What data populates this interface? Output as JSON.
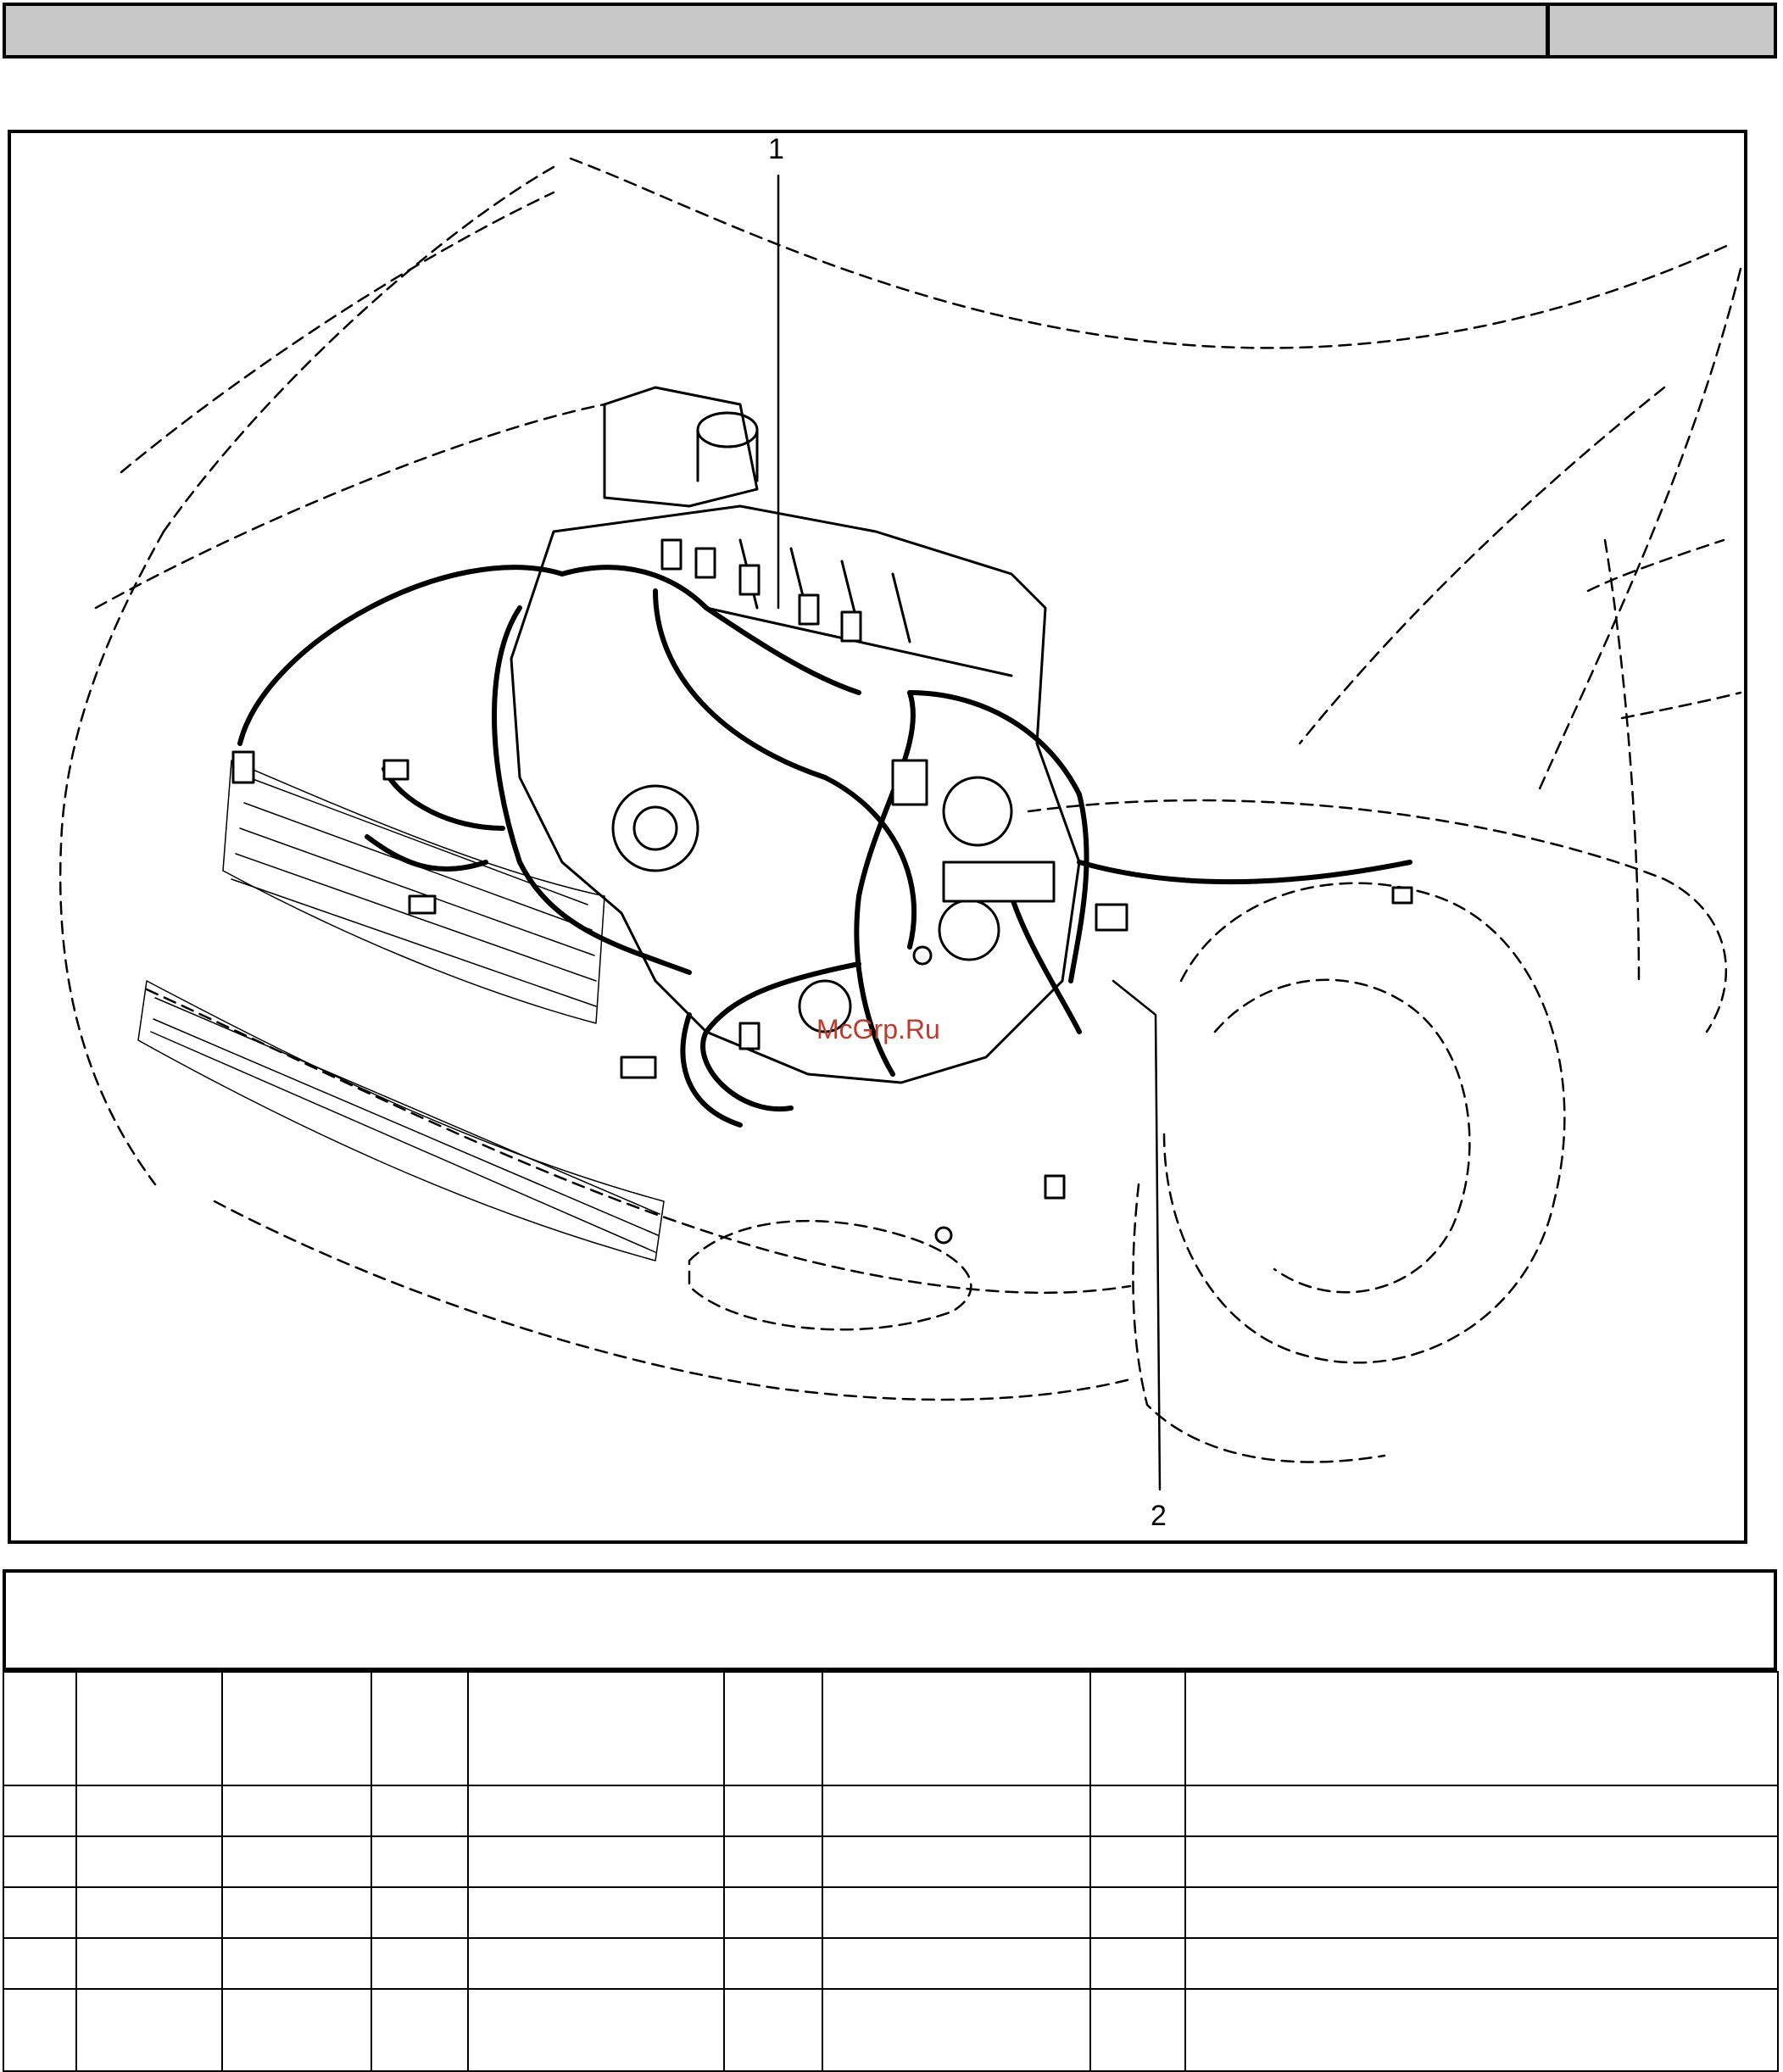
{
  "header": {
    "title": "",
    "code": ""
  },
  "figure": {
    "callouts": [
      {
        "id": "callout-1",
        "label": "1"
      },
      {
        "id": "callout-2",
        "label": "2"
      }
    ],
    "watermark": "McGrp.Ru"
  },
  "caption": {
    "text": ""
  },
  "parts_table": {
    "columns": 9,
    "rows": [
      [
        "",
        "",
        "",
        "",
        "",
        "",
        "",
        "",
        ""
      ],
      [
        "",
        "",
        "",
        "",
        "",
        "",
        "",
        "",
        ""
      ],
      [
        "",
        "",
        "",
        "",
        "",
        "",
        "",
        "",
        ""
      ],
      [
        "",
        "",
        "",
        "",
        "",
        "",
        "",
        "",
        ""
      ],
      [
        "",
        "",
        "",
        "",
        "",
        "",
        "",
        "",
        ""
      ],
      [
        "",
        "",
        "",
        "",
        "",
        "",
        "",
        "",
        ""
      ]
    ]
  }
}
